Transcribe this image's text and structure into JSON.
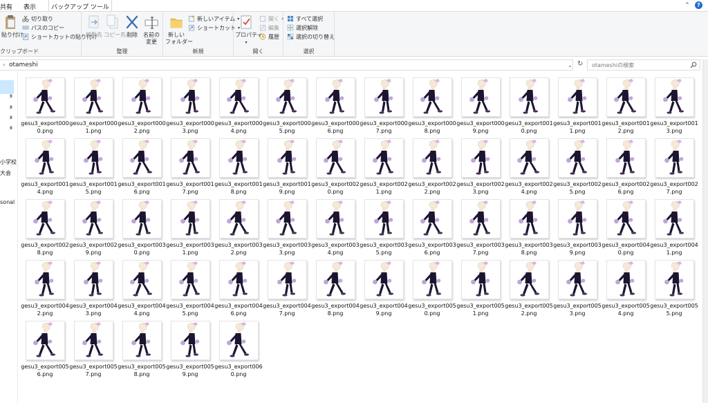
{
  "tabs": [
    "共有",
    "表示",
    "バックアップ ツール"
  ],
  "ribbon": {
    "clipboard": {
      "label": "クリップボード",
      "pin_label": "貼り付け",
      "cut": "切り取り",
      "copy_path": "パスのコピー",
      "paste_shortcut": "ショートカットの貼り付け"
    },
    "organize": {
      "label": "整理",
      "move_to": "移動先",
      "copy_to": "コピー先",
      "delete": "削除",
      "rename_line1": "名前の",
      "rename_line2": "変更"
    },
    "new": {
      "label": "新規",
      "new_folder_line1": "新しい",
      "new_folder_line2": "フォルダー",
      "new_item": "新しいアイテム",
      "shortcut": "ショートカット"
    },
    "open": {
      "label": "開く",
      "properties": "プロパティ",
      "open": "開く",
      "edit": "編集",
      "history": "履歴"
    },
    "select": {
      "label": "選択",
      "select_all": "すべて選択",
      "select_none": "選択解除",
      "invert": "選択の切り替え"
    }
  },
  "address": {
    "path": "otameshi",
    "search_placeholder": "otameshiの検索"
  },
  "nav": {
    "items": [
      "小学校",
      "大会",
      "sonal"
    ]
  },
  "files": [
    "gesu3_export0000.png",
    "gesu3_export0001.png",
    "gesu3_export0002.png",
    "gesu3_export0003.png",
    "gesu3_export0004.png",
    "gesu3_export0005.png",
    "gesu3_export0006.png",
    "gesu3_export0007.png",
    "gesu3_export0008.png",
    "gesu3_export0009.png",
    "gesu3_export0010.png",
    "gesu3_export0011.png",
    "gesu3_export0012.png",
    "gesu3_export0013.png",
    "gesu3_export0014.png",
    "gesu3_export0015.png",
    "gesu3_export0016.png",
    "gesu3_export0017.png",
    "gesu3_export0018.png",
    "gesu3_export0019.png",
    "gesu3_export0020.png",
    "gesu3_export0021.png",
    "gesu3_export0022.png",
    "gesu3_export0023.png",
    "gesu3_export0024.png",
    "gesu3_export0025.png",
    "gesu3_export0026.png",
    "gesu3_export0027.png",
    "gesu3_export0028.png",
    "gesu3_export0029.png",
    "gesu3_export0030.png",
    "gesu3_export0031.png",
    "gesu3_export0032.png",
    "gesu3_export0033.png",
    "gesu3_export0034.png",
    "gesu3_export0035.png",
    "gesu3_export0036.png",
    "gesu3_export0037.png",
    "gesu3_export0038.png",
    "gesu3_export0039.png",
    "gesu3_export0040.png",
    "gesu3_export0041.png",
    "gesu3_export0042.png",
    "gesu3_export0043.png",
    "gesu3_export0044.png",
    "gesu3_export0045.png",
    "gesu3_export0046.png",
    "gesu3_export0047.png",
    "gesu3_export0048.png",
    "gesu3_export0049.png",
    "gesu3_export0050.png",
    "gesu3_export0051.png",
    "gesu3_export0052.png",
    "gesu3_export0053.png",
    "gesu3_export0054.png",
    "gesu3_export0055.png",
    "gesu3_export0056.png",
    "gesu3_export0057.png",
    "gesu3_export0058.png",
    "gesu3_export0059.png",
    "gesu3_export0060.png"
  ],
  "colors": {
    "accent": "#1f6fd0",
    "nav_selected": "#cce8ff",
    "sprite_dark": "#1b1530",
    "sprite_light": "#b89ad8"
  },
  "icons": [
    "help-icon",
    "chevron-up-icon",
    "pin-icon",
    "cut-icon",
    "copy-path-icon",
    "paste-shortcut-icon",
    "move-to-icon",
    "copy-to-icon",
    "delete-icon",
    "rename-icon",
    "new-folder-icon",
    "new-item-icon",
    "shortcut-icon",
    "properties-icon",
    "open-icon",
    "edit-icon",
    "history-icon",
    "select-all-icon",
    "select-none-icon",
    "invert-selection-icon",
    "search-icon",
    "refresh-icon"
  ]
}
